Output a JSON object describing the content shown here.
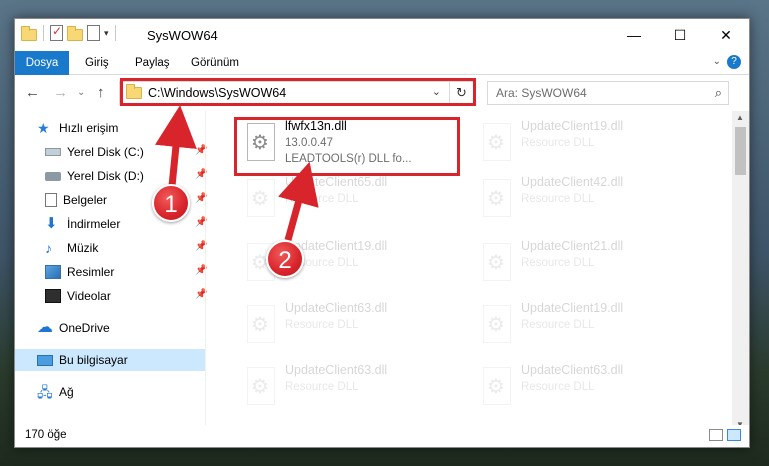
{
  "window": {
    "title": "SysWOW64",
    "controls": {
      "minimize": "—",
      "maximize": "☐",
      "close": "✕"
    }
  },
  "ribbon": {
    "tabs": [
      {
        "label": "Dosya"
      },
      {
        "label": "Giriş"
      },
      {
        "label": "Paylaş"
      },
      {
        "label": "Görünüm"
      }
    ],
    "help": "?"
  },
  "navigation": {
    "back": "←",
    "forward": "→",
    "recent": "⌄",
    "up": "↑",
    "address": "C:\\Windows\\SysWOW64",
    "dropdown": "⌄",
    "refresh": "↻",
    "search_placeholder": "Ara: SysWOW64",
    "search_icon": "⌕"
  },
  "sidebar": {
    "items": [
      {
        "label": "Hızlı erişim",
        "icon": "star-icon",
        "pinned": false
      },
      {
        "label": "Yerel Disk (C:)",
        "icon": "drive-icon",
        "pinned": true
      },
      {
        "label": "Yerel Disk (D:)",
        "icon": "drive-icon",
        "pinned": true
      },
      {
        "label": "Belgeler",
        "icon": "documents-icon",
        "pinned": true
      },
      {
        "label": "İndirmeler",
        "icon": "download-icon",
        "pinned": true
      },
      {
        "label": "Müzik",
        "icon": "music-icon",
        "pinned": true
      },
      {
        "label": "Resimler",
        "icon": "pictures-icon",
        "pinned": true
      },
      {
        "label": "Videolar",
        "icon": "videos-icon",
        "pinned": true
      },
      {
        "label": "OneDrive",
        "icon": "onedrive-icon",
        "pinned": false
      },
      {
        "label": "Bu bilgisayar",
        "icon": "this-pc-icon",
        "pinned": false,
        "selected": true
      },
      {
        "label": "Ağ",
        "icon": "network-icon",
        "pinned": false
      }
    ]
  },
  "files": [
    {
      "name": "lfwfx13n.dll",
      "version": "13.0.0.47",
      "desc": "LEADTOOLS(r) DLL fo...",
      "highlighted": true
    },
    {
      "name": "UpdateClient19.dll",
      "desc": "Resource DLL"
    },
    {
      "name": "UpdateClient65.dll",
      "desc": "Resource DLL"
    },
    {
      "name": "UpdateClient42.dll",
      "desc": "Resource DLL"
    },
    {
      "name": "UpdateClient19.dll",
      "desc": "Resource DLL"
    },
    {
      "name": "UpdateClient21.dll",
      "desc": "Resource DLL"
    },
    {
      "name": "UpdateClient63.dll",
      "desc": "Resource DLL"
    },
    {
      "name": "UpdateClient19.dll",
      "desc": "Resource DLL"
    },
    {
      "name": "UpdateClient63.dll",
      "desc": "Resource DLL"
    },
    {
      "name": "UpdateClient63.dll",
      "desc": "Resource DLL"
    }
  ],
  "status": {
    "count": "170 öğe"
  },
  "annotations": {
    "badge1": "1",
    "badge2": "2",
    "color": "#d8242b"
  }
}
